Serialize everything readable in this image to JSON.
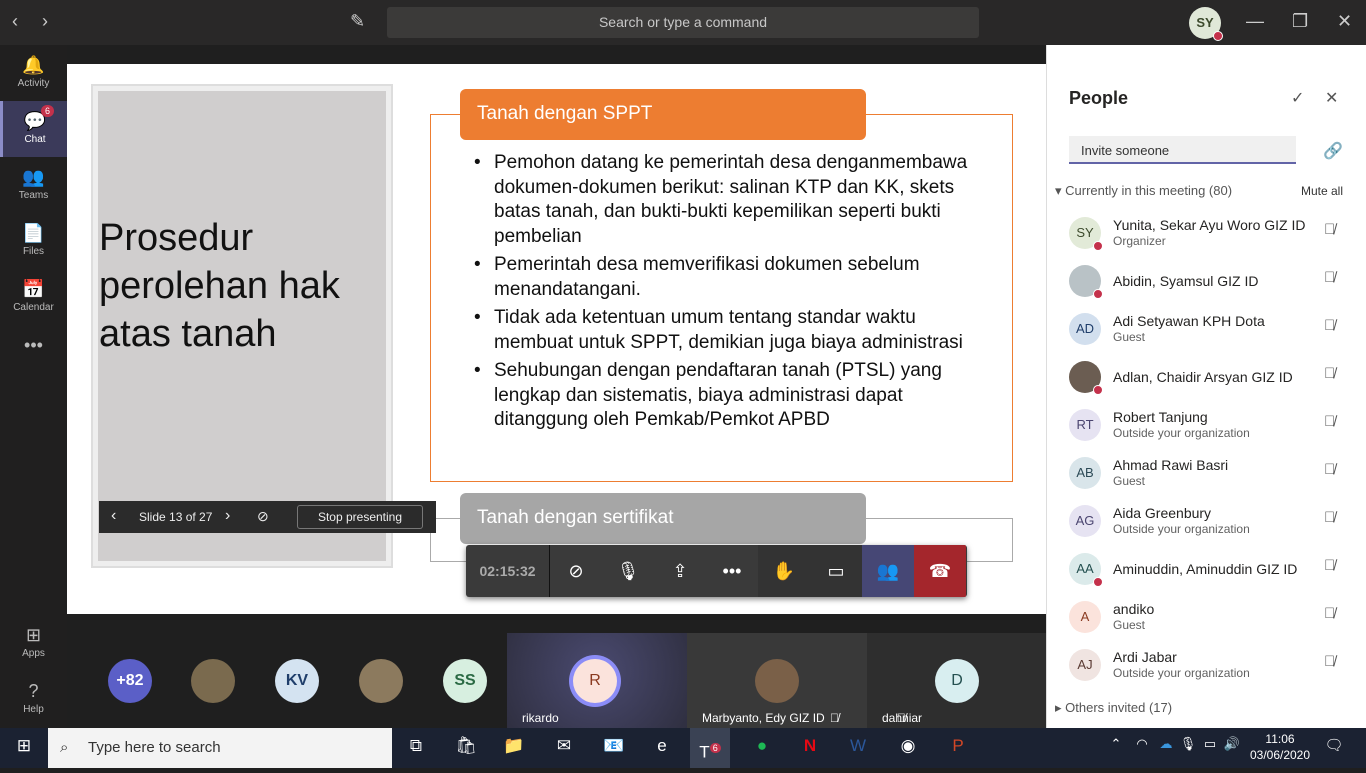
{
  "titlebar": {
    "search_placeholder": "Search or type a command",
    "user_initials": "SY"
  },
  "rail": [
    {
      "label": "Activity",
      "icon": "bell-icon",
      "glyph": "🔔"
    },
    {
      "label": "Chat",
      "icon": "chat-icon",
      "glyph": "💬",
      "badge": "6"
    },
    {
      "label": "Teams",
      "icon": "teams-icon",
      "glyph": "👥"
    },
    {
      "label": "Files",
      "icon": "file-icon",
      "glyph": "📄"
    },
    {
      "label": "Calendar",
      "icon": "calendar-icon",
      "glyph": "📅"
    },
    {
      "label": "",
      "icon": "more-icon",
      "glyph": "•••"
    }
  ],
  "rail_bottom": [
    {
      "label": "Apps",
      "icon": "apps-icon",
      "glyph": "⊞"
    },
    {
      "label": "Help",
      "icon": "help-icon",
      "glyph": "?"
    }
  ],
  "slide": {
    "title": "Prosedur perolehan hak atas tanah",
    "header1": "Tanah dengan SPPT",
    "bullets": [
      "Pemohon datang ke pemerintah desa denganmembawa  dokumen-dokumen berikut: salinan KTP dan KK, skets batas tanah, dan bukti-bukti kepemilikan seperti bukti pembelian",
      "Pemerintah desa memverifikasi dokumen sebelum menandatangani.",
      "Tidak ada ketentuan umum tentang standar waktu membuat untuk SPPT, demikian juga biaya administrasi",
      "Sehubungan dengan pendaftaran tanah (PTSL) yang lengkap dan sistematis, biaya administrasi dapat ditanggung oleh Pemkab/Pemkot APBD"
    ],
    "header2": "Tanah dengan sertifikat"
  },
  "presenter": {
    "slide_counter": "Slide 13 of 27",
    "stop_label": "Stop presenting"
  },
  "call": {
    "timer": "02:15:32"
  },
  "people": {
    "title": "People",
    "invite_placeholder": "Invite someone",
    "section": "Currently in this meeting (80)",
    "mute_all": "Mute all",
    "others": "Others invited (17)",
    "list": [
      {
        "name": "Yunita, Sekar Ayu Woro GIZ ID",
        "role": "Organizer",
        "initials": "SY",
        "bg": "#e2ead8",
        "fg": "#3c4a2c",
        "status": true
      },
      {
        "name": "Abidin, Syamsul GIZ ID",
        "role": "",
        "initials": "",
        "bg": "#b9c2c6",
        "fg": "#333",
        "status": true
      },
      {
        "name": "Adi Setyawan KPH Dota",
        "role": "Guest",
        "initials": "AD",
        "bg": "#d2dfee",
        "fg": "#1f3e6b",
        "status": false
      },
      {
        "name": "Adlan, Chaidir Arsyan GIZ ID",
        "role": "",
        "initials": "",
        "bg": "#6b5d52",
        "fg": "#fff",
        "status": true
      },
      {
        "name": "Robert Tanjung",
        "role": "Outside your organization",
        "initials": "RT",
        "bg": "#e6e3f2",
        "fg": "#4b4570",
        "status": false
      },
      {
        "name": "Ahmad Rawi Basri",
        "role": "Guest",
        "initials": "AB",
        "bg": "#d9e5ea",
        "fg": "#2c4a56",
        "status": false
      },
      {
        "name": "Aida Greenbury",
        "role": "Outside your organization",
        "initials": "AG",
        "bg": "#e6e3f2",
        "fg": "#4b4570",
        "status": false
      },
      {
        "name": "Aminuddin, Aminuddin GIZ ID",
        "role": "",
        "initials": "AA",
        "bg": "#dbeaea",
        "fg": "#245050",
        "status": true
      },
      {
        "name": "andiko",
        "role": "Guest",
        "initials": "A",
        "bg": "#fbe3dc",
        "fg": "#8a3a20",
        "status": false
      },
      {
        "name": "Ardi Jabar",
        "role": "Outside your organization",
        "initials": "AJ",
        "bg": "#f0e4e1",
        "fg": "#5a3a33",
        "status": false
      }
    ]
  },
  "strip": {
    "overflow": "+82",
    "avatars": [
      {
        "initials": "",
        "bg": "#7a6a4e"
      },
      {
        "initials": "KV",
        "bg": "#d4e3f1",
        "fg": "#1f3e6b"
      },
      {
        "initials": "",
        "bg": "#8c7a5e"
      },
      {
        "initials": "SS",
        "bg": "#d7efe0",
        "fg": "#2a6a44"
      }
    ],
    "tiles": [
      {
        "name": "rikardo",
        "initials": "R"
      },
      {
        "name": "Marbyanto, Edy GIZ ID",
        "initials": ""
      },
      {
        "name": "dahniar",
        "initials": "D"
      }
    ]
  },
  "taskbar": {
    "search_placeholder": "Type here to search",
    "time": "11:06",
    "date": "03/06/2020",
    "teams_badge": "6"
  }
}
